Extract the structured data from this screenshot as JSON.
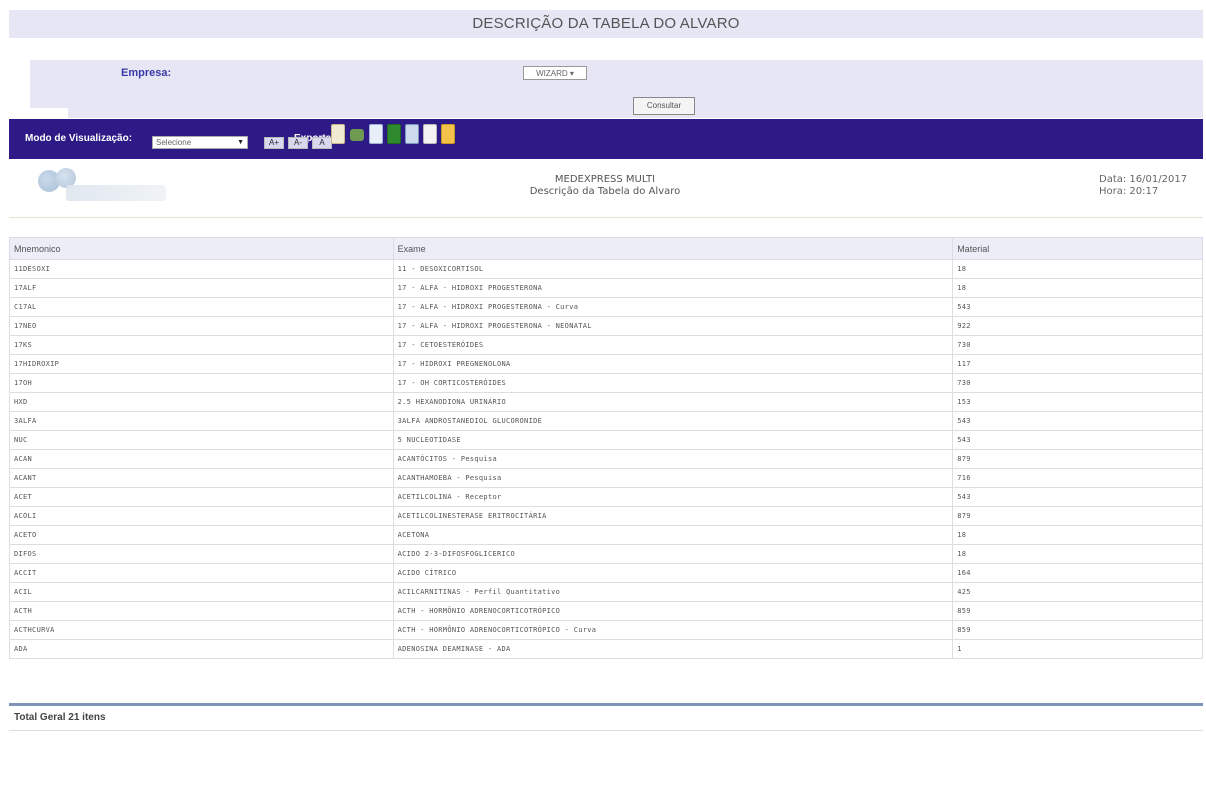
{
  "page_title": "DESCRIÇÃO DA TABELA DO ALVARO",
  "filter": {
    "empresa_label": "Empresa:",
    "empresa_value": "WIZARD ▾",
    "consultar_label": "Consultar"
  },
  "toolbar": {
    "mode_label": "Modo de Visualização:",
    "mode_value": "Selecione",
    "font_larger": "A+",
    "font_smaller": "A-",
    "font_normal": "A",
    "export_label": "Exportar:",
    "export_icons": [
      "pdf-icon",
      "print-icon",
      "doc-icon",
      "excel-icon",
      "csv-icon",
      "html-icon",
      "txt-icon"
    ]
  },
  "report": {
    "company": "MEDEXPRESS MULTI",
    "subtitle": "Descrição da Tabela do Alvaro",
    "date": "Data: 16/01/2017",
    "time": "Hora: 20:17"
  },
  "table": {
    "columns": [
      "Mnemonico",
      "Exame",
      "Material"
    ],
    "rows": [
      [
        "11DESOXI",
        "11 - DESOXICORTISOL",
        "18"
      ],
      [
        "17ALF",
        "17 - ALFA - HIDROXI PROGESTERONA",
        "18"
      ],
      [
        "C17AL",
        "17 - ALFA - HIDROXI PROGESTERONA - Curva",
        "543"
      ],
      [
        "17NEO",
        "17 - ALFA - HIDROXI PROGESTERONA - NEONATAL",
        "922"
      ],
      [
        "17KS",
        "17 - CETOESTERÓIDES",
        "730"
      ],
      [
        "17HIDROXIP",
        "17 - HIDROXI PREGNENOLONA",
        "117"
      ],
      [
        "17OH",
        "17 - OH CORTICOSTERÓIDES",
        "730"
      ],
      [
        "HXD",
        "2.5 HEXANODIONA URINÁRIO",
        "153"
      ],
      [
        "3ALFA",
        "3ALFA ANDROSTANEDIOL GLUCORONIDE",
        "543"
      ],
      [
        "NUC",
        "5 NUCLEOTIDASE",
        "543"
      ],
      [
        "ACAN",
        "ACANTÓCITOS - Pesquisa",
        "879"
      ],
      [
        "ACANT",
        "ACANTHAMOEBA - Pesquisa",
        "716"
      ],
      [
        "ACET",
        "ACETILCOLINA - Receptor",
        "543"
      ],
      [
        "ACOLI",
        "ACETILCOLINESTERASE ERITROCITÁRIA",
        "879"
      ],
      [
        "ACETO",
        "ACETONA",
        "18"
      ],
      [
        "DIFOS",
        "ACIDO 2-3-DIFOSFOGLICERICO",
        "18"
      ],
      [
        "ACCIT",
        "ACIDO CÍTRICO",
        "164"
      ],
      [
        "ACIL",
        "ACILCARNITINAS - Perfil Quantitativo",
        "425"
      ],
      [
        "ACTH",
        "ACTH - HORMÔNIO ADRENOCORTICOTRÓPICO",
        "859"
      ],
      [
        "ACTHCURVA",
        "ACTH - HORMÔNIO ADRENOCORTICOTRÓPICO - Curva",
        "859"
      ],
      [
        "ADA",
        "ADENOSINA DEAMINASE - ADA",
        "1"
      ]
    ]
  },
  "total_label": "Total Geral 21 itens",
  "colors": {
    "toolbar_bg": "#2d1a86",
    "panel_bg": "#e6e6f5",
    "label_blue": "#3a3aa8"
  }
}
